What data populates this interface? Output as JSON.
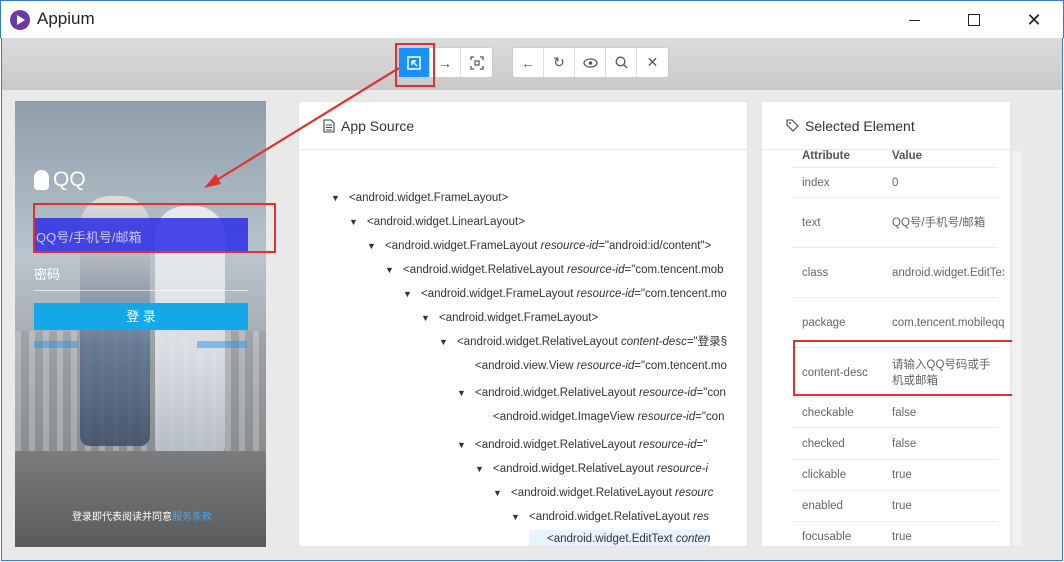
{
  "window": {
    "title": "Appium",
    "minimize": "—",
    "maximize": "□",
    "close": "✕"
  },
  "toolbar": {
    "group1": [
      {
        "icon": "select-element-icon",
        "glyph": "⬚",
        "active": true
      },
      {
        "icon": "swipe-arrow-icon",
        "glyph": "→",
        "active": false
      },
      {
        "icon": "tap-coordinate-icon",
        "glyph": "⛶",
        "active": false
      }
    ],
    "group2": [
      {
        "icon": "back-icon",
        "glyph": "←"
      },
      {
        "icon": "refresh-icon",
        "glyph": "↻"
      },
      {
        "icon": "eye-icon",
        "glyph": "👁"
      },
      {
        "icon": "search-icon",
        "glyph": "⌕"
      },
      {
        "icon": "close-session-icon",
        "glyph": "✕"
      }
    ]
  },
  "device": {
    "brand": "QQ",
    "account_placeholder": "QQ号/手机号/邮箱",
    "password_label": "密码",
    "login_button": "登 录",
    "agreement_text": "登录即代表阅读并同意",
    "agreement_link": "服务条款"
  },
  "app_source": {
    "title": "App Source",
    "rows": [
      {
        "depth": 0,
        "arrow": "▼",
        "tag": "<android.widget.FrameLayout>",
        "attr": "",
        "val": ""
      },
      {
        "depth": 1,
        "arrow": "▼",
        "tag": "<android.widget.LinearLayout>",
        "attr": "",
        "val": ""
      },
      {
        "depth": 2,
        "arrow": "▼",
        "tag": "<android.widget.FrameLayout ",
        "attr": "resource-id",
        "val": "=\"android:id/content\">"
      },
      {
        "depth": 3,
        "arrow": "▼",
        "tag": "<android.widget.RelativeLayout ",
        "attr": "resource-id",
        "val": "=\"com.tencent.mob"
      },
      {
        "depth": 4,
        "arrow": "▼",
        "tag": "<android.widget.FrameLayout ",
        "attr": "resource-id",
        "val": "=\"com.tencent.mo"
      },
      {
        "depth": 5,
        "arrow": "▼",
        "tag": "<android.widget.FrameLayout>",
        "attr": "",
        "val": ""
      },
      {
        "depth": 6,
        "arrow": "▼",
        "tag": "<android.widget.RelativeLayout ",
        "attr": "content-desc",
        "val": "=\"登录§"
      },
      {
        "depth": 7,
        "arrow": "",
        "tag": "<android.view.View ",
        "attr": "resource-id",
        "val": "=\"com.tencent.mo"
      },
      {
        "depth": 7,
        "arrow": "▼",
        "tag": "<android.widget.RelativeLayout ",
        "attr": "resource-id",
        "val": "=\"con"
      },
      {
        "depth": 8,
        "arrow": "",
        "tag": "<android.widget.ImageView ",
        "attr": "resource-id",
        "val": "=\"con"
      },
      {
        "depth": 7,
        "arrow": "▼",
        "tag": "<android.widget.RelativeLayout ",
        "attr": "resource-id",
        "val": "=\""
      },
      {
        "depth": 8,
        "arrow": "▼",
        "tag": "<android.widget.RelativeLayout ",
        "attr": "resource-i",
        "val": ""
      },
      {
        "depth": 9,
        "arrow": "▼",
        "tag": "<android.widget.RelativeLayout ",
        "attr": "resourc",
        "val": ""
      },
      {
        "depth": 10,
        "arrow": "▼",
        "tag": "<android.widget.RelativeLayout ",
        "attr": "res",
        "val": ""
      },
      {
        "depth": 11,
        "arrow": "",
        "tag": "<android.widget.EditText ",
        "attr": "conten",
        "val": "",
        "selected": true
      }
    ]
  },
  "selected_element": {
    "title": "Selected Element",
    "header": {
      "attribute": "Attribute",
      "value": "Value"
    },
    "rows": [
      {
        "key": "index",
        "value": "0"
      },
      {
        "key": "text",
        "value": "QQ号/手机号/邮箱"
      },
      {
        "key": "class",
        "value": "android.widget.EditText"
      },
      {
        "key": "package",
        "value": "com.tencent.mobileqq"
      },
      {
        "key": "content-desc",
        "value": "请输入QQ号码或手机或邮箱"
      },
      {
        "key": "checkable",
        "value": "false"
      },
      {
        "key": "checked",
        "value": "false"
      },
      {
        "key": "clickable",
        "value": "true"
      },
      {
        "key": "enabled",
        "value": "true"
      },
      {
        "key": "focusable",
        "value": "true"
      }
    ]
  },
  "colors": {
    "accent": "#1890ff",
    "highlight": "#e03030",
    "device_input": "#2d2de6"
  }
}
